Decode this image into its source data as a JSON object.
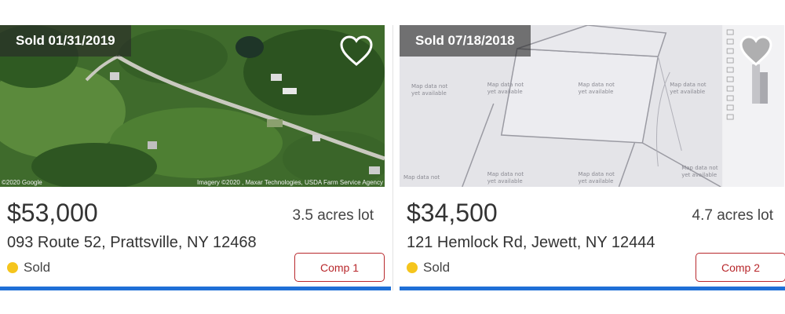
{
  "cards": [
    {
      "sold_tag": "Sold 01/31/2019",
      "price": "$53,000",
      "lot_size": "3.5 acres lot",
      "address": "093 Route 52, Prattsville, NY 12468",
      "status": "Sold",
      "comp_label": "Comp 1",
      "image_credit_left": "©2020 Google",
      "image_credit_right": "Imagery ©2020 , Maxar Technologies, USDA Farm Service Agency",
      "image_type": "satellite"
    },
    {
      "sold_tag": "Sold 07/18/2018",
      "price": "$34,500",
      "lot_size": "4.7 acres lot",
      "address": "121 Hemlock Rd, Jewett, NY 12444",
      "status": "Sold",
      "comp_label": "Comp 2",
      "image_type": "parcel-map"
    }
  ],
  "colors": {
    "accent_blue": "#1f6fd6",
    "comp_red": "#b8282c",
    "sold_dot": "#f5c51d"
  },
  "icons": {
    "favorite": "heart-outline-icon",
    "status": "status-dot-icon"
  }
}
